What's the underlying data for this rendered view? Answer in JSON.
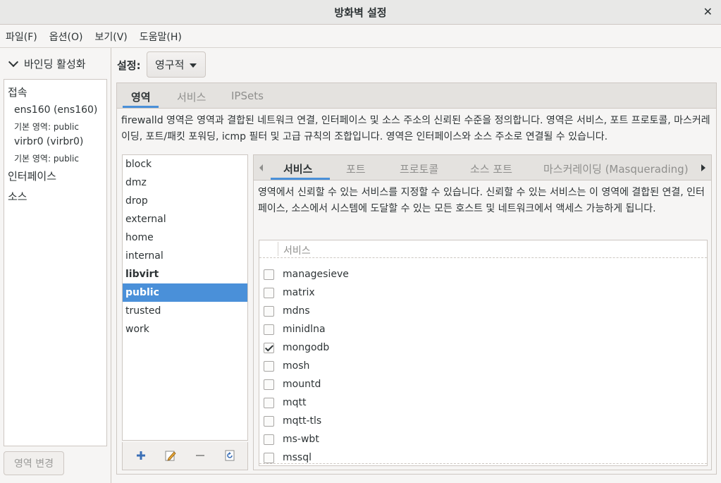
{
  "window": {
    "title": "방화벽 설정",
    "close_glyph": "✕"
  },
  "menu": [
    "파일(F)",
    "옵션(O)",
    "보기(V)",
    "도움말(H)"
  ],
  "left": {
    "binding_toggle": "바인딩 활성화",
    "connections_header": "접속",
    "connections": [
      {
        "name": "ens160 (ens160)",
        "zone_prefix": "기본 영역: ",
        "zone": "public"
      },
      {
        "name": "virbr0 (virbr0)",
        "zone_prefix": "기본 영역: ",
        "zone": "public"
      }
    ],
    "interfaces_header": "인터페이스",
    "sources_header": "소스",
    "change_zone_button": "영역 변경"
  },
  "config": {
    "label": "설정:",
    "value": "영구적"
  },
  "top_tabs": [
    "영역",
    "서비스",
    "IPSets"
  ],
  "zone_description": "firewalld 영역은 영역과 결합된 네트워크 연결, 인터페이스 및 소스 주소의 신뢰된 수준을 정의합니다. 영역은 서비스, 포트 프로토콜, 마스커레이딩, 포트/패킷 포워딩, icmp 필터 및 고급 규칙의 조합입니다. 영역은 인터페이스와 소스 주소로 연결될 수 있습니다.",
  "zones": [
    "block",
    "dmz",
    "drop",
    "external",
    "home",
    "internal",
    "libvirt",
    "public",
    "trusted",
    "work"
  ],
  "selected_zone": "public",
  "inner_tabs": [
    "서비스",
    "포트",
    "프로토콜",
    "소스 포트",
    "마스커레이딩 (Masquerading)"
  ],
  "services_description": "영역에서 신뢰할 수 있는 서비스를 지정할 수 있습니다. 신뢰할 수 있는 서비스는 이 영역에 결합된 연결, 인터페이스, 소스에서 시스템에 도달할 수 있는 모든 호스트 및 네트워크에서 액세스 가능하게 됩니다.",
  "services_column": "서비스",
  "services": [
    {
      "name": "managesieve",
      "checked": false
    },
    {
      "name": "matrix",
      "checked": false
    },
    {
      "name": "mdns",
      "checked": false
    },
    {
      "name": "minidlna",
      "checked": false
    },
    {
      "name": "mongodb",
      "checked": true
    },
    {
      "name": "mosh",
      "checked": false
    },
    {
      "name": "mountd",
      "checked": false
    },
    {
      "name": "mqtt",
      "checked": false
    },
    {
      "name": "mqtt-tls",
      "checked": false
    },
    {
      "name": "ms-wbt",
      "checked": false
    },
    {
      "name": "mssql",
      "checked": false
    }
  ],
  "colors": {
    "accent": "#4a90d9"
  }
}
